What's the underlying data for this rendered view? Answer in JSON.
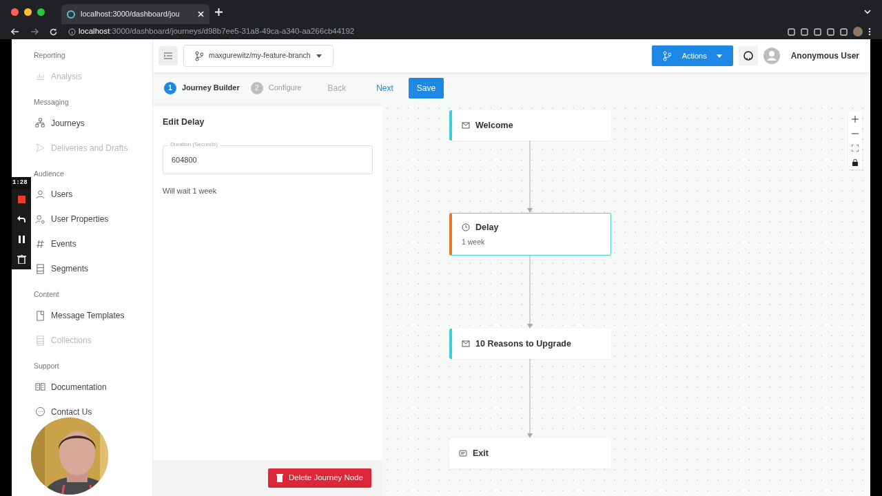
{
  "browser": {
    "tab_title": "localhost:3000/dashboard/jou",
    "url_host": "localhost",
    "url_rest": ":3000/dashboard/journeys/d98b7ee5-31a8-49ca-a340-aa266cb44192"
  },
  "sidebar": {
    "sections": [
      {
        "heading": "Reporting",
        "items": [
          {
            "label": "Analysis",
            "disabled": true
          }
        ]
      },
      {
        "heading": "Messaging",
        "items": [
          {
            "label": "Journeys",
            "disabled": false
          },
          {
            "label": "Deliveries and Drafts",
            "disabled": true
          }
        ]
      },
      {
        "heading": "Audience",
        "items": [
          {
            "label": "Users",
            "disabled": false
          },
          {
            "label": "User Properties",
            "disabled": false
          },
          {
            "label": "Events",
            "disabled": false
          },
          {
            "label": "Segments",
            "disabled": false
          }
        ]
      },
      {
        "heading": "Content",
        "items": [
          {
            "label": "Message Templates",
            "disabled": false
          },
          {
            "label": "Collections",
            "disabled": true
          }
        ]
      },
      {
        "heading": "Support",
        "items": [
          {
            "label": "Documentation",
            "disabled": false
          },
          {
            "label": "Contact Us",
            "disabled": false
          }
        ]
      }
    ]
  },
  "topbar": {
    "branch": "maxgurewitz/my-feature-branch",
    "actions": "Actions",
    "user": "Anonymous User"
  },
  "stepper": {
    "steps": [
      {
        "number": "1",
        "label": "Journey Builder",
        "selected": true
      },
      {
        "number": "2",
        "label": "Configure",
        "selected": false
      }
    ],
    "back": {
      "label": "Back",
      "disabled": true
    },
    "next": "Next",
    "save": "Save"
  },
  "editor": {
    "title": "Edit Delay",
    "field": {
      "label": "Duration (Seconds)",
      "value": "604800"
    },
    "help": "Will wait 1 week",
    "delete_button": "Delete Journey Node"
  },
  "canvas": {
    "nodes": [
      {
        "kind": "message",
        "title": "Welcome",
        "selected": false
      },
      {
        "kind": "delay",
        "title": "Delay",
        "subtitle": "1 week",
        "selected": true
      },
      {
        "kind": "message",
        "title": "10 Reasons to Upgrade",
        "selected": false
      },
      {
        "kind": "exit",
        "title": "Exit",
        "selected": false
      }
    ]
  },
  "recorder": {
    "timer": "1:28"
  }
}
